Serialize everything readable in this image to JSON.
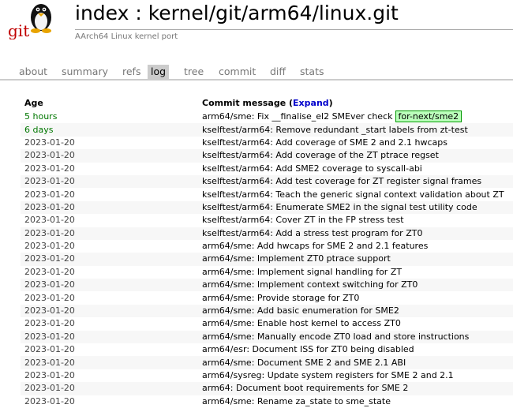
{
  "header": {
    "title": "index : kernel/git/arm64/linux.git",
    "description": "AArch64 Linux kernel port",
    "logo_text": "git"
  },
  "tabs": [
    {
      "label": "about"
    },
    {
      "label": "summary"
    },
    {
      "label": "refs"
    },
    {
      "label": "log",
      "active": true
    },
    {
      "label": "tree"
    },
    {
      "label": "commit"
    },
    {
      "label": "diff"
    },
    {
      "label": "stats"
    }
  ],
  "table": {
    "headers": {
      "age": "Age",
      "message_prefix": "Commit message (",
      "expand": "Expand",
      "message_suffix": ")"
    },
    "rows": [
      {
        "age": "5 hours",
        "message": "arm64/sme: Fix __finalise_el2 SMEver check",
        "branch": "for-next/sme2"
      },
      {
        "age": "6 days",
        "message": "kselftest/arm64: Remove redundant _start labels from zt-test"
      },
      {
        "age": "2023-01-20",
        "message": "kselftest/arm64: Add coverage of SME 2 and 2.1 hwcaps"
      },
      {
        "age": "2023-01-20",
        "message": "kselftest/arm64: Add coverage of the ZT ptrace regset"
      },
      {
        "age": "2023-01-20",
        "message": "kselftest/arm64: Add SME2 coverage to syscall-abi"
      },
      {
        "age": "2023-01-20",
        "message": "kselftest/arm64: Add test coverage for ZT register signal frames"
      },
      {
        "age": "2023-01-20",
        "message": "kselftest/arm64: Teach the generic signal context validation about ZT"
      },
      {
        "age": "2023-01-20",
        "message": "kselftest/arm64: Enumerate SME2 in the signal test utility code"
      },
      {
        "age": "2023-01-20",
        "message": "kselftest/arm64: Cover ZT in the FP stress test"
      },
      {
        "age": "2023-01-20",
        "message": "kselftest/arm64: Add a stress test program for ZT0"
      },
      {
        "age": "2023-01-20",
        "message": "arm64/sme: Add hwcaps for SME 2 and 2.1 features"
      },
      {
        "age": "2023-01-20",
        "message": "arm64/sme: Implement ZT0 ptrace support"
      },
      {
        "age": "2023-01-20",
        "message": "arm64/sme: Implement signal handling for ZT"
      },
      {
        "age": "2023-01-20",
        "message": "arm64/sme: Implement context switching for ZT0"
      },
      {
        "age": "2023-01-20",
        "message": "arm64/sme: Provide storage for ZT0"
      },
      {
        "age": "2023-01-20",
        "message": "arm64/sme: Add basic enumeration for SME2"
      },
      {
        "age": "2023-01-20",
        "message": "arm64/sme: Enable host kernel to access ZT0"
      },
      {
        "age": "2023-01-20",
        "message": "arm64/sme: Manually encode ZT0 load and store instructions"
      },
      {
        "age": "2023-01-20",
        "message": "arm64/esr: Document ISS for ZT0 being disabled"
      },
      {
        "age": "2023-01-20",
        "message": "arm64/sme: Document SME 2 and SME 2.1 ABI"
      },
      {
        "age": "2023-01-20",
        "message": "arm64/sysreg: Update system registers for SME 2 and 2.1"
      },
      {
        "age": "2023-01-20",
        "message": "arm64: Document boot requirements for SME 2"
      },
      {
        "age": "2023-01-20",
        "message": "arm64/sme: Rename za_state to sme_state"
      }
    ]
  }
}
